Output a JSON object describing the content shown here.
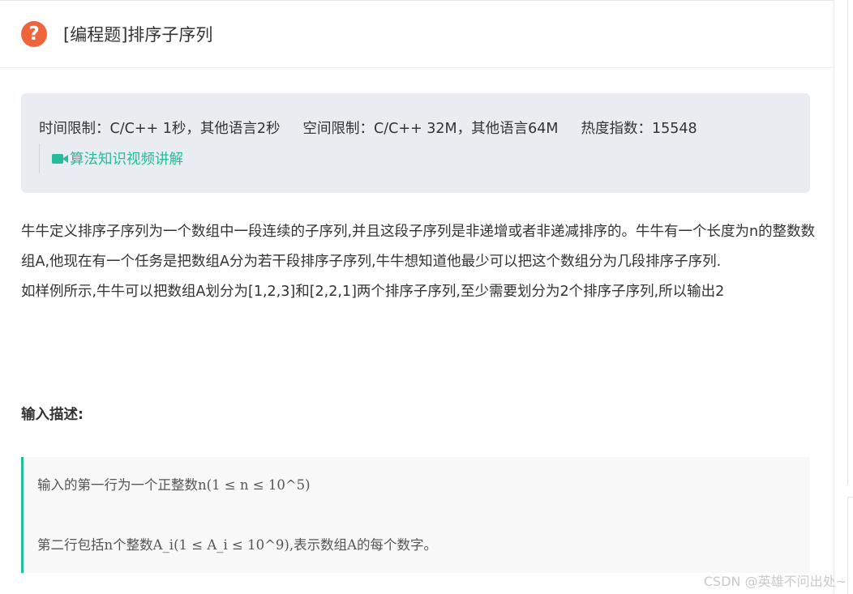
{
  "header": {
    "icon": "question-circle-icon",
    "icon_glyph": "?",
    "title": "[编程题]排序子序列"
  },
  "limits": {
    "time": "时间限制：C/C++ 1秒，其他语言2秒",
    "space": "空间限制：C/C++ 32M，其他语言64M",
    "heat": "热度指数：15548",
    "video_link": "算法知识视频讲解",
    "video_icon": "camera-icon"
  },
  "description": {
    "paragraphs": [
      "牛牛定义排序子序列为一个数组中一段连续的子序列,并且这段子序列是非递增或者非递减排序的。牛牛有一个长度为n的整数数组A,他现在有一个任务是把数组A分为若干段排序子序列,牛牛想知道他最少可以把这个数组分为几段排序子序列.",
      "如样例所示,牛牛可以把数组A划分为[1,2,3]和[2,2,1]两个排序子序列,至少需要划分为2个排序子序列,所以输出2"
    ]
  },
  "input_section": {
    "title": "输入描述:",
    "lines": [
      "输入的第一行为一个正整数n(1 ≤ n ≤ 10^5)",
      "第二行包括n个整数A_i(1 ≤ A_i ≤ 10^9),表示数组A的每个数字。"
    ]
  },
  "watermark": "CSDN @英雄不问出处~",
  "colors": {
    "accent": "#25bb9b",
    "icon_orange": "#f0643c",
    "limits_bg": "#e9edf1"
  }
}
